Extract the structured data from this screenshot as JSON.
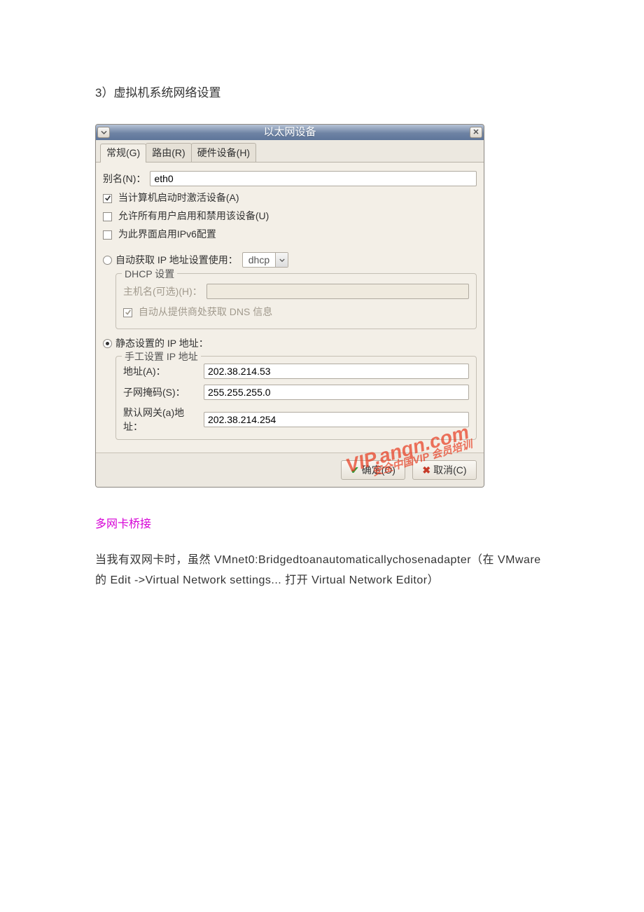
{
  "section": {
    "heading": "3）虚拟机系统网络设置",
    "multi_nic_heading": "多网卡桥接",
    "body_text": "当我有双网卡时，虽然 VMnet0:Bridgedtoanautomaticallychosenadapter（在 VMware 的 Edit ->Virtual Network settings... 打开 Virtual Network Editor）"
  },
  "dialog": {
    "title": "以太网设备",
    "tabs": {
      "general": "常规(G)",
      "route": "路由(R)",
      "hardware": "硬件设备(H)"
    },
    "alias_label": "别名(N)：",
    "alias_value": "eth0",
    "checkbox_activate": "当计算机启动时激活设备(A)",
    "checkbox_allow_all": "允许所有用户启用和禁用该设备(U)",
    "checkbox_ipv6": "为此界面启用IPv6配置",
    "radio_auto": "自动获取 IP 地址设置使用：",
    "dhcp_select": "dhcp",
    "dhcp_group_title": "DHCP 设置",
    "dhcp_host_label": "主机名(可选)(H)：",
    "dhcp_dns_label": "自动从提供商处获取 DNS 信息",
    "radio_static": "静态设置的 IP 地址：",
    "static_group_title": "手工设置 IP 地址",
    "addr_label": "地址(A)：",
    "addr_value": "202.38.214.53",
    "mask_label": "子网掩码(S)：",
    "mask_value": "255.255.255.0",
    "gateway_label": "默认网关(a)地址：",
    "gateway_value": "202.38.214.254",
    "ok_label": "确定(O)",
    "cancel_label": "取消(C)"
  },
  "watermark": {
    "line1": "VIP.anqn.com",
    "line2": "安全中国VIP 会员培训"
  }
}
